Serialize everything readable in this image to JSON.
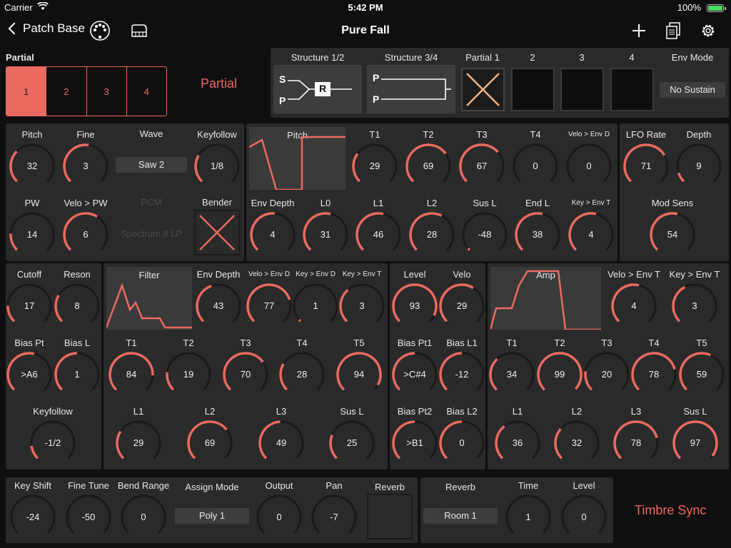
{
  "status": {
    "carrier": "Carrier",
    "time": "5:42 PM",
    "battery": "100%"
  },
  "nav": {
    "back_label": "Patch Base",
    "title": "Pure Fall"
  },
  "partial_panel": {
    "heading": "Partial",
    "buttons": [
      "1",
      "2",
      "3",
      "4"
    ],
    "side_label": "Partial"
  },
  "structure": {
    "headers": [
      "Structure 1/2",
      "Structure 3/4",
      "Partial 1",
      "2",
      "3",
      "4",
      "Env Mode"
    ],
    "s12": {
      "top": "S",
      "bottom": "P",
      "box": "R"
    },
    "s34": {
      "top": "P",
      "bottom": "P"
    },
    "env_mode": "No Sustain"
  },
  "wg": {
    "pitch": {
      "label": "Pitch",
      "value": "32"
    },
    "fine": {
      "label": "Fine",
      "value": "3"
    },
    "wave_label": "Wave",
    "wave_value": "Saw 2",
    "keyfollow": {
      "label": "Keyfollow",
      "value": "1/8"
    },
    "pw": {
      "label": "PW",
      "value": "14"
    },
    "velo_pw": {
      "label": "Velo > PW",
      "value": "6"
    },
    "pcm_label": "PCM",
    "pcm_value": "Spectrum 8 LP",
    "bender_label": "Bender"
  },
  "pitch_env": {
    "graph_label": "Pitch",
    "knobs_top": [
      {
        "label": "T1",
        "value": "29"
      },
      {
        "label": "T2",
        "value": "69"
      },
      {
        "label": "T3",
        "value": "67"
      },
      {
        "label": "T4",
        "value": "0"
      },
      {
        "label": "Velo > Env D",
        "value": "0"
      }
    ],
    "knobs_bottom": [
      {
        "label": "Env Depth",
        "value": "4"
      },
      {
        "label": "L0",
        "value": "31"
      },
      {
        "label": "L1",
        "value": "46"
      },
      {
        "label": "L2",
        "value": "28"
      },
      {
        "label": "Sus L",
        "value": "-48"
      },
      {
        "label": "End L",
        "value": "38"
      },
      {
        "label": "Key > Env T",
        "value": "4"
      }
    ]
  },
  "lfo": {
    "rate": {
      "label": "LFO Rate",
      "value": "71"
    },
    "depth": {
      "label": "Depth",
      "value": "9"
    },
    "mod_sens": {
      "label": "Mod Sens",
      "value": "54"
    }
  },
  "tvf_left": {
    "cutoff": {
      "label": "Cutoff",
      "value": "17"
    },
    "reson": {
      "label": "Reson",
      "value": "8"
    },
    "bias_pt": {
      "label": "Bias Pt",
      "value": ">A6"
    },
    "bias_l": {
      "label": "Bias L",
      "value": "1"
    },
    "keyfollow": {
      "label": "Keyfollow",
      "value": "-1/2"
    }
  },
  "filter_env": {
    "graph_label": "Filter",
    "top": [
      {
        "label": "Env Depth",
        "value": "43"
      },
      {
        "label": "Velo > Env D",
        "value": "77"
      },
      {
        "label": "Key > Env D",
        "value": "1"
      },
      {
        "label": "Key > Env T",
        "value": "3"
      }
    ],
    "times": [
      {
        "label": "T1",
        "value": "84"
      },
      {
        "label": "T2",
        "value": "19"
      },
      {
        "label": "T3",
        "value": "70"
      },
      {
        "label": "T4",
        "value": "28"
      },
      {
        "label": "T5",
        "value": "94"
      }
    ],
    "levels": [
      {
        "label": "L1",
        "value": "29"
      },
      {
        "label": "L2",
        "value": "69"
      },
      {
        "label": "L3",
        "value": "49"
      },
      {
        "label": "Sus L",
        "value": "25"
      }
    ]
  },
  "tva_left": {
    "level": {
      "label": "Level",
      "value": "93"
    },
    "velo": {
      "label": "Velo",
      "value": "29"
    },
    "bias_pt1": {
      "label": "Bias Pt1",
      "value": ">C#4"
    },
    "bias_l1": {
      "label": "Bias L1",
      "value": "-12"
    },
    "bias_pt2": {
      "label": "Bias Pt2",
      "value": ">B1"
    },
    "bias_l2": {
      "label": "Bias L2",
      "value": "0"
    }
  },
  "amp_env": {
    "graph_label": "Amp",
    "top": [
      {
        "label": "Velo > Env T",
        "value": "4"
      },
      {
        "label": "Key > Env T",
        "value": "3"
      }
    ],
    "times": [
      {
        "label": "T1",
        "value": "34"
      },
      {
        "label": "T2",
        "value": "99"
      },
      {
        "label": "T3",
        "value": "20"
      },
      {
        "label": "T4",
        "value": "78"
      },
      {
        "label": "T5",
        "value": "59"
      }
    ],
    "levels": [
      {
        "label": "L1",
        "value": "36"
      },
      {
        "label": "L2",
        "value": "32"
      },
      {
        "label": "L3",
        "value": "78"
      },
      {
        "label": "Sus L",
        "value": "97"
      }
    ]
  },
  "common": {
    "key_shift": {
      "label": "Key Shift",
      "value": "-24"
    },
    "fine_tune": {
      "label": "Fine Tune",
      "value": "-50"
    },
    "bend_range": {
      "label": "Bend Range",
      "value": "0"
    },
    "assign_mode_label": "Assign Mode",
    "assign_mode_value": "Poly 1",
    "output": {
      "label": "Output",
      "value": "0"
    },
    "pan": {
      "label": "Pan",
      "value": "-7"
    },
    "reverb_label": "Reverb"
  },
  "reverb": {
    "type_label": "Reverb",
    "type_value": "Room 1",
    "time": {
      "label": "Time",
      "value": "1"
    },
    "level": {
      "label": "Level",
      "value": "0"
    }
  },
  "timbre_sync": "Timbre Sync",
  "colors": {
    "accent": "#ea6a5f",
    "panel": "#2a2a2a",
    "track": "#1a1a1a"
  }
}
